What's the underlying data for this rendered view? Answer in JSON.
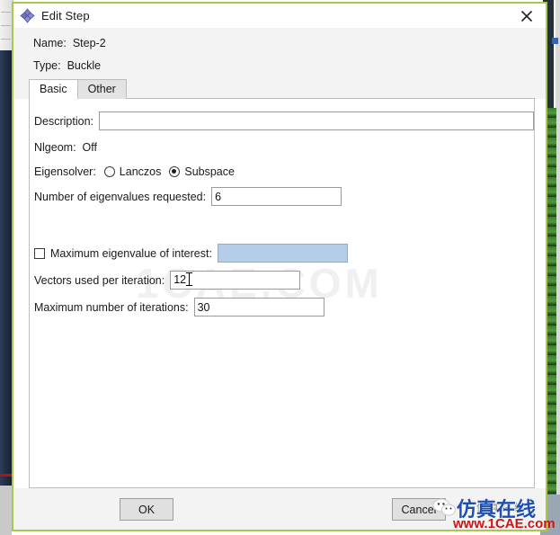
{
  "window": {
    "title": "Edit Step",
    "icon": "step-diamond-icon",
    "close_label": "✕",
    "border_color": "#a8c84a"
  },
  "header": {
    "name_label": "Name:",
    "name_value": "Step-2",
    "type_label": "Type:",
    "type_value": "Buckle"
  },
  "tabs": [
    {
      "label": "Basic",
      "active": true
    },
    {
      "label": "Other",
      "active": false
    }
  ],
  "form": {
    "description": {
      "label": "Description:",
      "value": "",
      "placeholder": ""
    },
    "nlgeom": {
      "label": "Nlgeom:",
      "value": "Off"
    },
    "eigensolver": {
      "label": "Eigensolver:",
      "options": [
        {
          "label": "Lanczos",
          "selected": false
        },
        {
          "label": "Subspace",
          "selected": true
        }
      ]
    },
    "num_eigenvalues": {
      "label": "Number of eigenvalues requested:",
      "value": "6"
    },
    "max_eigenvalue": {
      "label": "Maximum eigenvalue of interest:",
      "checked": false,
      "value": "",
      "disabled": true,
      "field_color": "#b4cde8"
    },
    "vectors_per_iteration": {
      "label": "Vectors used per iteration:",
      "value": "12"
    },
    "max_iterations": {
      "label": "Maximum number of iterations:",
      "value": "30"
    }
  },
  "footer": {
    "ok_label": "OK",
    "cancel_label": "Cancel"
  },
  "watermarks": {
    "body_text": "1CAE.COM",
    "brand_cn": "仿真在线",
    "brand_url": "www.1CAE.com",
    "brand_gray": "仿真在线",
    "brand_color_blue": "#1f4fb0",
    "brand_color_red": "#d01414"
  }
}
